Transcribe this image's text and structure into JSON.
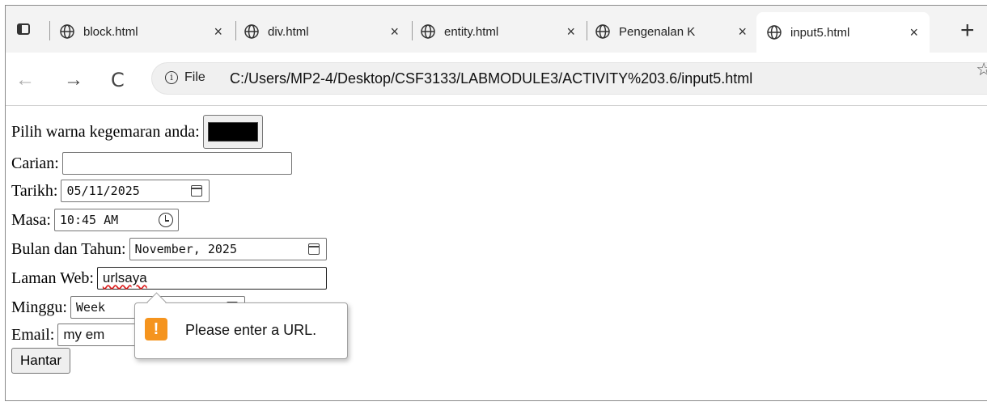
{
  "browser": {
    "tabs": [
      {
        "title": "block.html",
        "close": "×"
      },
      {
        "title": "div.html",
        "close": "×"
      },
      {
        "title": "entity.html",
        "close": "×"
      },
      {
        "title": "Pengenalan K",
        "close": "×"
      },
      {
        "title": "input5.html",
        "close": "×",
        "active": true
      }
    ],
    "new_tab": "+",
    "nav": {
      "back": "←",
      "forward": "→",
      "reload": "C"
    },
    "omnibox": {
      "info": "i",
      "scheme_label": "File",
      "url": "C:/Users/MP2-4/Desktop/CSF3133/LABMODULE3/ACTIVITY%203.6/input5.html",
      "star": "☆"
    }
  },
  "form": {
    "color": {
      "label": "Pilih warna kegemaran anda:",
      "value": "#000000"
    },
    "search": {
      "label": "Carian:",
      "value": ""
    },
    "date": {
      "label": "Tarikh:",
      "value": "05/11/2025"
    },
    "time": {
      "label": "Masa:",
      "value": "10:45 AM"
    },
    "month": {
      "label": "Bulan dan Tahun:",
      "value": "November, 2025"
    },
    "url": {
      "label": "Laman Web:",
      "value": "urlsaya"
    },
    "week": {
      "label": "Minggu:",
      "value": "Week"
    },
    "email": {
      "label": "Email:",
      "value": "my em"
    },
    "submit": {
      "label": "Hantar"
    }
  },
  "validation": {
    "icon": "!",
    "message": "Please enter a URL."
  },
  "colors": {
    "warning": "#f5941e",
    "tabstrip": "#f3f3f3"
  }
}
